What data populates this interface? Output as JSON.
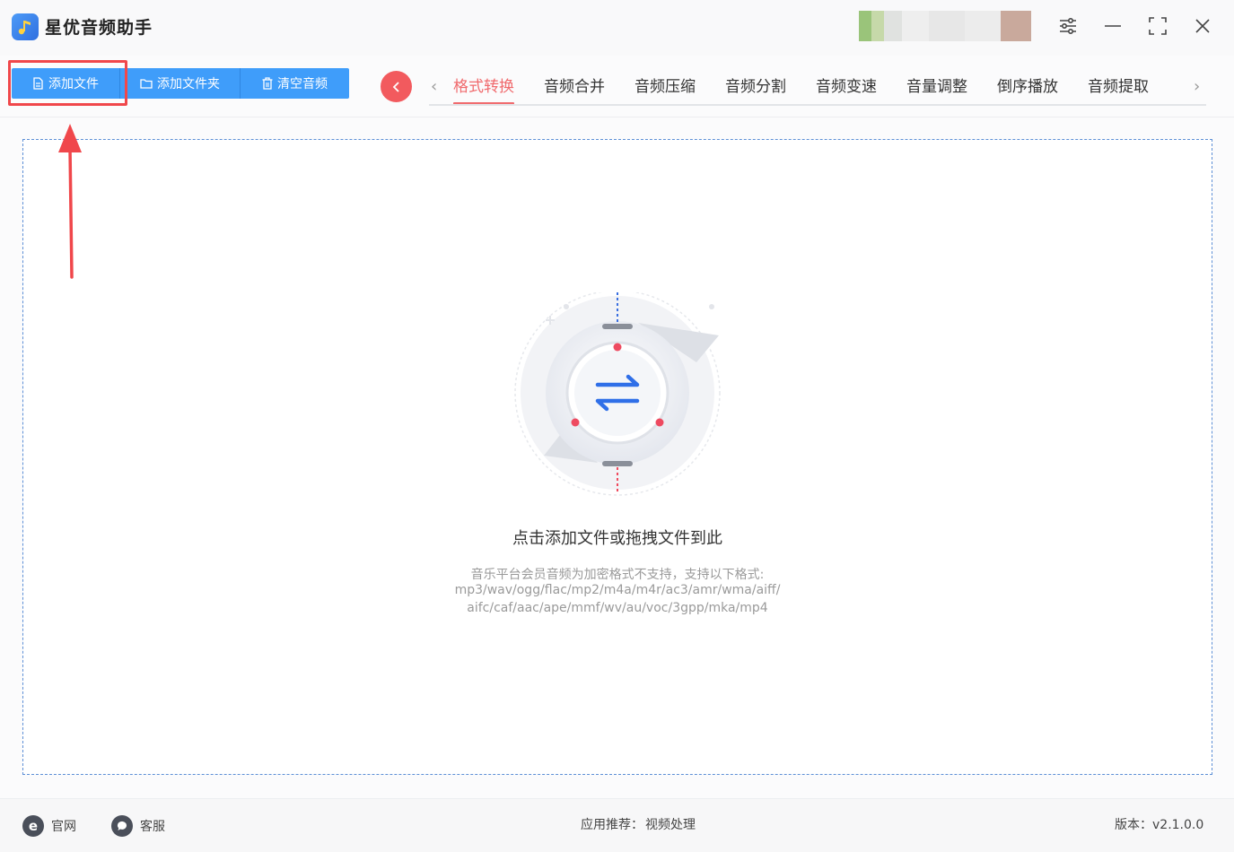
{
  "app": {
    "title": "星优音频助手"
  },
  "toolbar": {
    "add_file": "添加文件",
    "add_folder": "添加文件夹",
    "clear_audio": "清空音频"
  },
  "tabs": [
    {
      "label": "格式转换",
      "active": true
    },
    {
      "label": "音频合并",
      "active": false
    },
    {
      "label": "音频压缩",
      "active": false
    },
    {
      "label": "音频分割",
      "active": false
    },
    {
      "label": "音频变速",
      "active": false
    },
    {
      "label": "音量调整",
      "active": false
    },
    {
      "label": "倒序播放",
      "active": false
    },
    {
      "label": "音频提取",
      "active": false
    }
  ],
  "dropzone": {
    "title": "点击添加文件或拖拽文件到此",
    "hint_line1": "音乐平台会员音频为加密格式不支持，支持以下格式:",
    "hint_line2": "mp3/wav/ogg/flac/mp2/m4a/m4r/ac3/amr/wma/aiff/",
    "hint_line3": "aifc/caf/aac/ape/mmf/wv/au/voc/3gpp/mka/mp4"
  },
  "footer": {
    "website": "官网",
    "support": "客服",
    "recommend_label": "应用推荐：",
    "recommend_link": "视频处理",
    "version": "版本：v2.1.0.0"
  },
  "colors": {
    "accent_blue": "#3f9dfa",
    "accent_red": "#f06a6d",
    "annotation_red": "#f0474b"
  },
  "icons": {
    "settings": "sliders-icon",
    "minimize": "minimize-icon",
    "maximize": "maximize-icon",
    "close": "close-icon"
  }
}
